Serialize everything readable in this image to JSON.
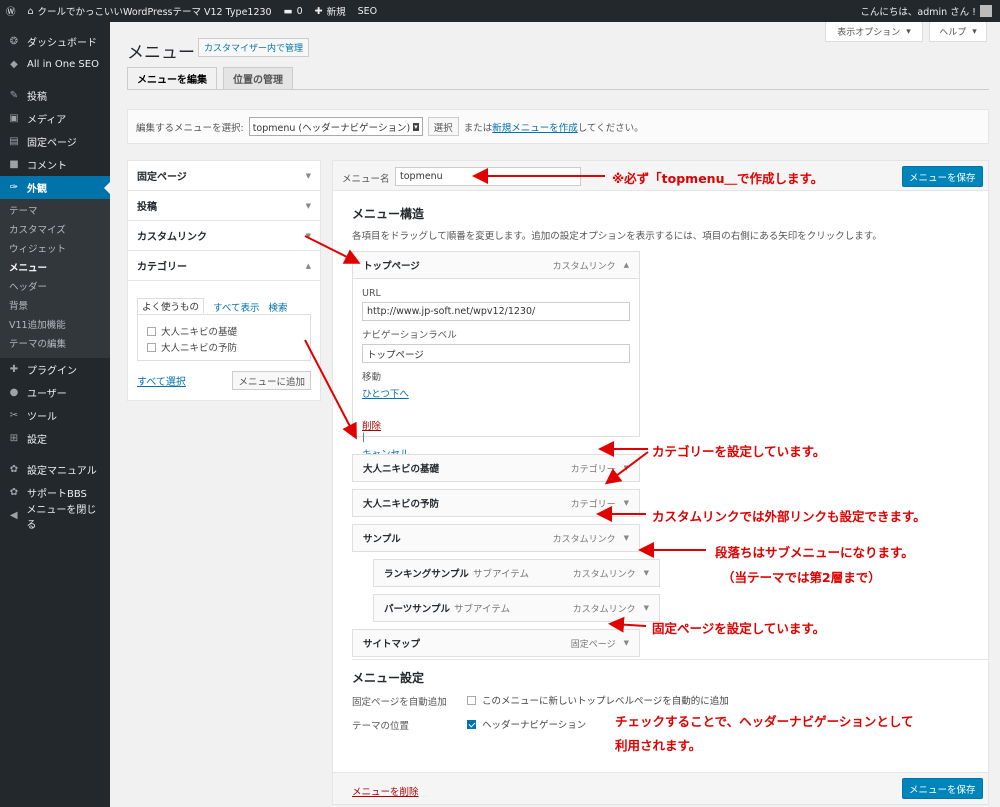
{
  "admin_bar": {
    "site_name": "クールでかっこいいWordPressテーマ V12 Type1230",
    "comments": "0",
    "new": "新規",
    "seo": "SEO",
    "greeting": "こんにちは、admin さん !"
  },
  "sidebar": {
    "items_top": [
      {
        "icon": "❂",
        "label": "ダッシュボード"
      },
      {
        "icon": "◆",
        "label": "All in One SEO"
      }
    ],
    "items_mid": [
      {
        "icon": "✎",
        "label": "投稿"
      },
      {
        "icon": "▣",
        "label": "メディア"
      },
      {
        "icon": "▤",
        "label": "固定ページ"
      },
      {
        "icon": "■",
        "label": "コメント"
      }
    ],
    "current": {
      "icon": "✑",
      "label": "外観"
    },
    "submenu": [
      "テーマ",
      "カスタマイズ",
      "ウィジェット",
      "メニュー",
      "ヘッダー",
      "背景",
      "V11追加機能",
      "テーマの編集"
    ],
    "items_bottom": [
      {
        "icon": "✚",
        "label": "プラグイン"
      },
      {
        "icon": "●",
        "label": "ユーザー"
      },
      {
        "icon": "✂",
        "label": "ツール"
      },
      {
        "icon": "⊞",
        "label": "設定"
      }
    ],
    "items_extra": [
      {
        "icon": "✿",
        "label": "設定マニュアル"
      },
      {
        "icon": "✿",
        "label": "サポートBBS"
      },
      {
        "icon": "◀",
        "label": "メニューを閉じる"
      }
    ]
  },
  "header": {
    "screen_options": "表示オプション",
    "help": "ヘルプ",
    "title": "メニュー",
    "customizer_button": "カスタマイザー内で管理"
  },
  "tabs": [
    "メニューを編集",
    "位置の管理"
  ],
  "select_bar": {
    "label": "編集するメニューを選択:",
    "selected": "topmenu (ヘッダーナビゲーション)",
    "select_button": "選択",
    "or_text": "または",
    "create_link": "新規メニューを作成",
    "suffix": "してください。"
  },
  "accordion": {
    "sections": [
      "固定ページ",
      "投稿",
      "カスタムリンク"
    ],
    "open_section": "カテゴリー",
    "sub_tabs": [
      "よく使うもの",
      "すべて表示",
      "検索"
    ],
    "categories": [
      "大人ニキビの基礎",
      "大人ニキビの予防"
    ],
    "select_all": "すべて選択",
    "add_button": "メニューに追加"
  },
  "editor": {
    "menu_name_label": "メニュー名",
    "menu_name": "topmenu",
    "save_button": "メニューを保存",
    "structure_title": "メニュー構造",
    "structure_desc": "各項目をドラッグして順番を変更します。追加の設定オプションを表示するには、項目の右側にある矢印をクリックします。",
    "open_item": {
      "title": "トップページ",
      "type": "カスタムリンク",
      "url_label": "URL",
      "url": "http://www.jp-soft.net/wpv12/1230/",
      "nav_label_label": "ナビゲーションラベル",
      "nav_label": "トップページ",
      "move_label": "移動",
      "move_link": "ひとつ下へ",
      "delete": "削除",
      "sep": "|",
      "cancel": "キャンセル"
    },
    "items": [
      {
        "title": "大人ニキビの基礎",
        "sub": "",
        "type": "カテゴリー"
      },
      {
        "title": "大人ニキビの予防",
        "sub": "",
        "type": "カテゴリー"
      },
      {
        "title": "サンプル",
        "sub": "",
        "type": "カスタムリンク"
      },
      {
        "title": "ランキングサンプル",
        "sub": "サブアイテム",
        "type": "カスタムリンク"
      },
      {
        "title": "パーツサンプル",
        "sub": "サブアイテム",
        "type": "カスタムリンク"
      },
      {
        "title": "サイトマップ",
        "sub": "",
        "type": "固定ページ"
      }
    ],
    "settings_title": "メニュー設定",
    "auto_add_label": "固定ページを自動追加",
    "auto_add_text": "このメニューに新しいトップレベルページを自動的に追加",
    "location_label": "テーマの位置",
    "location_text": "ヘッダーナビゲーション",
    "delete_menu": "メニューを削除"
  },
  "annotations": {
    "a1": "※必ず「topmenu＿で作成します。",
    "a2": "カテゴリーを設定しています。",
    "a3": "カスタムリンクでは外部リンクも設定できます。",
    "a4": "段落ちはサブメニューになります。",
    "a5": "（当テーマでは第2層まで）",
    "a6": "固定ページを設定しています。",
    "a7": "チェックすることで、ヘッダーナビゲーションとして",
    "a8": "利用されます。",
    "color": "#e00000"
  }
}
